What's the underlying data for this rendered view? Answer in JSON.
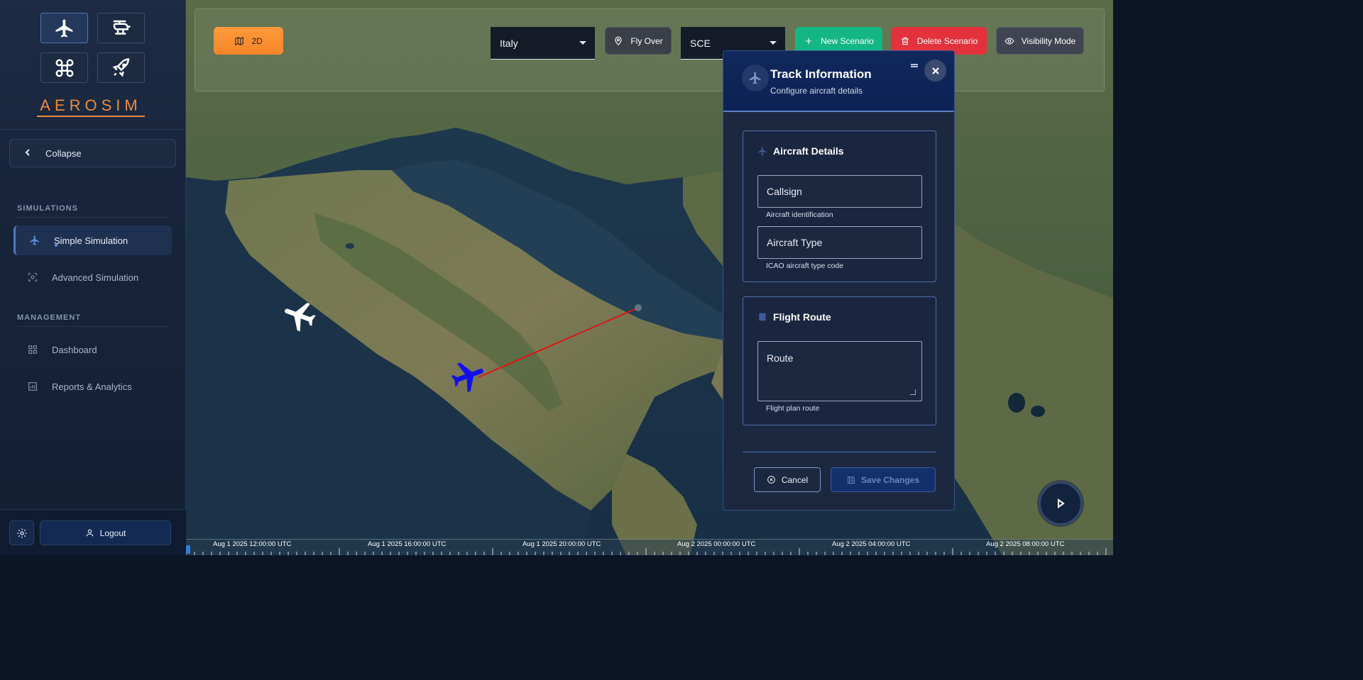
{
  "app": {
    "logo": "AEROSIM"
  },
  "sidebar": {
    "vehicle_types": [
      {
        "name": "airplane-icon",
        "active": true
      },
      {
        "name": "helicopter-icon",
        "active": false
      },
      {
        "name": "drone-icon",
        "active": false
      },
      {
        "name": "rocket-icon",
        "active": false
      }
    ],
    "collapse_label": "Collapse",
    "sections": {
      "simulations": "SIMULATIONS",
      "management": "MANAGEMENT"
    },
    "items": [
      {
        "label": "Simple Simulation",
        "icon": "airplane-icon",
        "active": true
      },
      {
        "label": "Advanced Simulation",
        "icon": "scan-icon",
        "active": false
      },
      {
        "label": "Dashboard",
        "icon": "grid-icon",
        "active": false
      },
      {
        "label": "Reports & Analytics",
        "icon": "bar-chart-icon",
        "active": false
      }
    ],
    "logout_label": "Logout"
  },
  "toolbar": {
    "view_mode_label": "2D",
    "region_select": {
      "value": "Italy"
    },
    "fly_over_label": "Fly Over",
    "scenario_select": {
      "value": "SCE"
    },
    "new_scenario_label": "New Scenario",
    "delete_scenario_label": "Delete Scenario",
    "visibility_mode_label": "Visibility Mode"
  },
  "track_panel": {
    "title": "Track Information",
    "subtitle": "Configure aircraft details",
    "aircraft_details": {
      "title": "Aircraft Details",
      "callsign_placeholder": "Callsign",
      "callsign_help": "Aircraft identification",
      "aircraft_type_placeholder": "Aircraft Type",
      "aircraft_type_help": "ICAO aircraft type code"
    },
    "flight_route": {
      "title": "Flight Route",
      "route_placeholder": "Route",
      "route_help": "Flight plan route"
    },
    "cancel_label": "Cancel",
    "save_label": "Save Changes"
  },
  "map": {
    "aircraft": [
      {
        "name": "white-aircraft",
        "color": "#ffffff"
      },
      {
        "name": "blue-aircraft",
        "color": "#1010ee"
      }
    ],
    "route_color": "#e01515"
  },
  "timeline": {
    "labels": [
      "Aug 1 2025 12:00:00 UTC",
      "Aug 1 2025 16:00:00 UTC",
      "Aug 1 2025 20:00:00 UTC",
      "Aug 2 2025 00:00:00 UTC",
      "Aug 2 2025 04:00:00 UTC",
      "Aug 2 2025 08:00:00 UTC"
    ]
  },
  "colors": {
    "accent_orange": "#f08a3a",
    "new_scenario_green": "#14b783",
    "delete_red": "#e3323c",
    "panel_header_blue": "#0c2255"
  }
}
